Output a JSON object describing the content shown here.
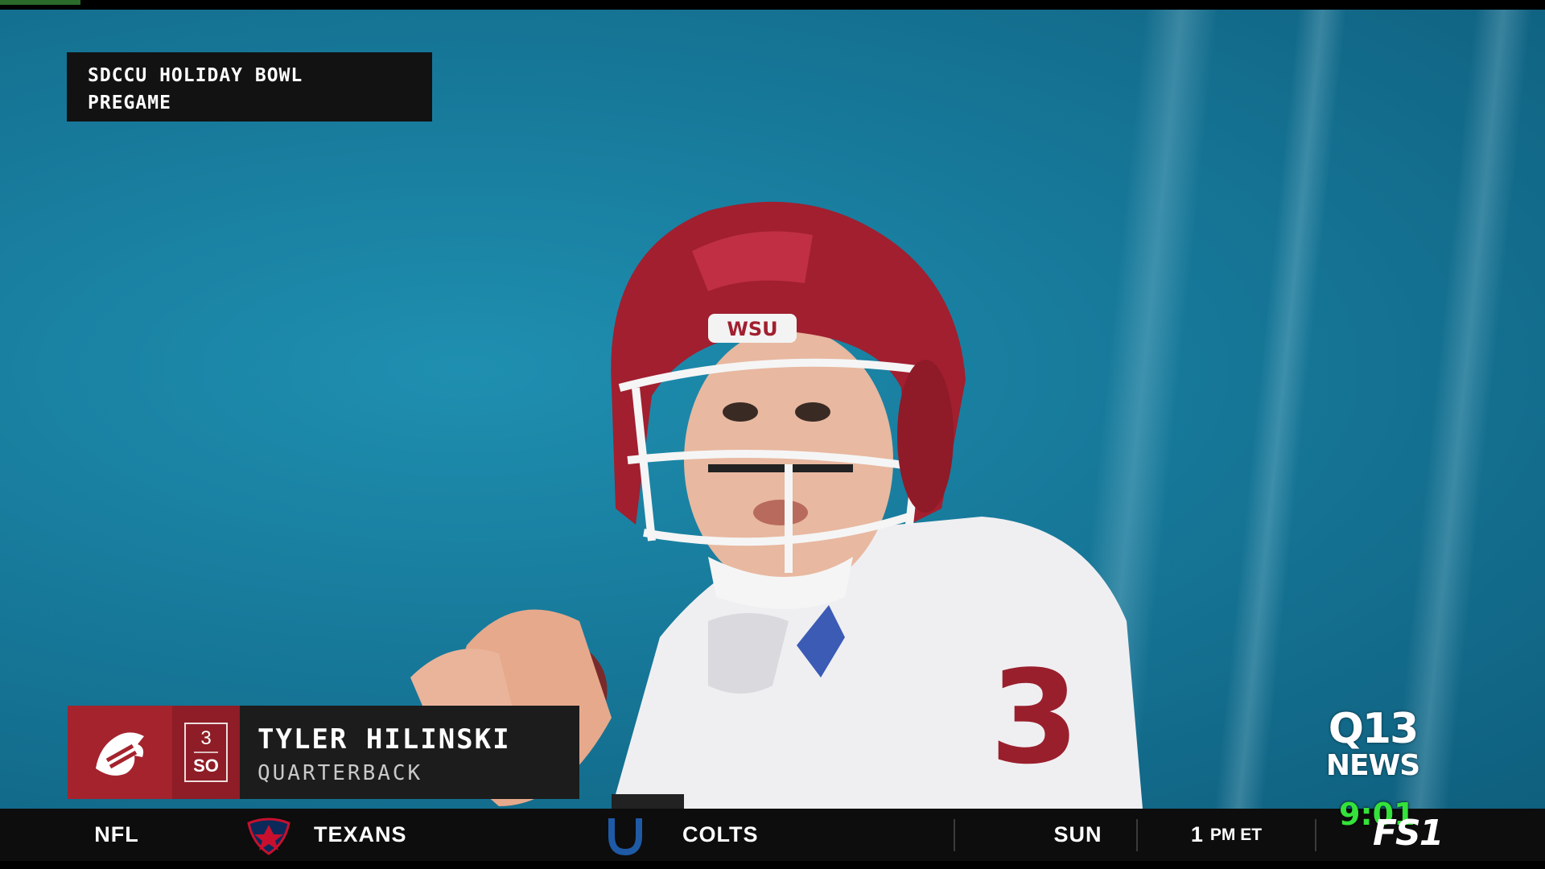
{
  "broadcast_tag": {
    "line1": "SDCCU HOLIDAY BOWL",
    "line2": "PREGAME"
  },
  "player_graphic": {
    "helmet_text": "WSU",
    "jersey_number": "3"
  },
  "lower_third": {
    "team_logo": "wsu-cougar-logo",
    "number": "3",
    "class_year": "SO",
    "name": "TYLER HILINSKI",
    "position": "QUARTERBACK",
    "colors": {
      "team_primary": "#a4232d",
      "team_dark": "#8e1d27",
      "name_bg": "#1c1c1c"
    }
  },
  "station_bug": {
    "line1": "Q13",
    "line2": "NEWS",
    "clock": "9:01",
    "clock_color": "#34e23a"
  },
  "ticker": {
    "league": "NFL",
    "away_team": "TEXANS",
    "away_logo": "texans-logo",
    "home_team": "COLTS",
    "home_logo": "colts-horseshoe-logo",
    "day": "SUN",
    "time": "1",
    "time_suffix": "PM ET",
    "network": "FS1"
  }
}
